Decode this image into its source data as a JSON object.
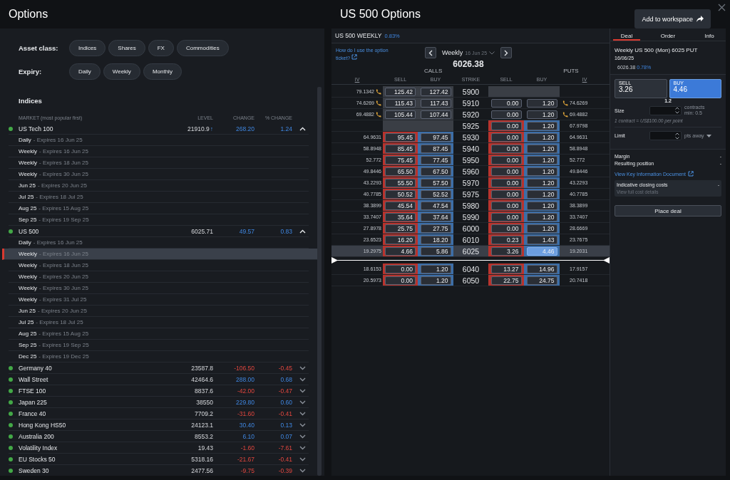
{
  "header": {
    "title": "Options",
    "chain_title": "US 500 Options",
    "add_button": "Add to workspace"
  },
  "filters": [
    {
      "label": "Asset class:",
      "chips": [
        "Indices",
        "Shares",
        "FX",
        "Commodities"
      ]
    },
    {
      "label": "Expiry:",
      "chips": [
        "Daily",
        "Weekly",
        "Monthly"
      ]
    }
  ],
  "market_list": {
    "title": "Indices",
    "columns": [
      "MARKET (most popular first)",
      "LEVEL",
      "CHANGE",
      "% CHANGE"
    ],
    "markets": [
      {
        "name": "US Tech 100",
        "open": true,
        "level": "21910.9",
        "level_arrow": "↑",
        "change": "268.20",
        "pct": "1.24",
        "rising": true,
        "expanded": true,
        "expiries": [
          {
            "label": "Daily",
            "detail": "- Expires 16 Jun 25",
            "selected": false
          },
          {
            "label": "Weekly",
            "detail": "- Expires 16 Jun 25",
            "selected": false
          },
          {
            "label": "Weekly",
            "detail": "- Expires 18 Jun 25",
            "selected": false
          },
          {
            "label": "Weekly",
            "detail": "- Expires 30 Jun 25",
            "selected": false
          },
          {
            "label": "Jun 25",
            "detail": "- Expires 20 Jun 25",
            "selected": false
          },
          {
            "label": "Jul 25",
            "detail": "- Expires 18 Jul 25",
            "selected": false
          },
          {
            "label": "Aug 25",
            "detail": "- Expires 15 Aug 25",
            "selected": false
          },
          {
            "label": "Sep 25",
            "detail": "- Expires 19 Sep 25",
            "selected": false
          }
        ]
      },
      {
        "name": "US 500",
        "open": true,
        "level": "6025.71",
        "change": "49.57",
        "pct": "0.83",
        "rising": true,
        "expanded": true,
        "expiries": [
          {
            "label": "Daily",
            "detail": "- Expires 16 Jun 25",
            "selected": false
          },
          {
            "label": "Weekly",
            "detail": "- Expires 16 Jun 25",
            "selected": true
          },
          {
            "label": "Weekly",
            "detail": "- Expires 18 Jun 25",
            "selected": false
          },
          {
            "label": "Weekly",
            "detail": "- Expires 20 Jun 25",
            "selected": false
          },
          {
            "label": "Weekly",
            "detail": "- Expires 30 Jun 25",
            "selected": false
          },
          {
            "label": "Weekly",
            "detail": "- Expires 31 Jul 25",
            "selected": false
          },
          {
            "label": "Jun 25",
            "detail": "- Expires 20 Jun 25",
            "selected": false
          },
          {
            "label": "Jul 25",
            "detail": "- Expires 18 Jul 25",
            "selected": false
          },
          {
            "label": "Aug 25",
            "detail": "- Expires 15 Aug 25",
            "selected": false
          },
          {
            "label": "Sep 25",
            "detail": "- Expires 19 Sep 25",
            "selected": false
          },
          {
            "label": "Dec 25",
            "detail": "- Expires 19 Dec 25",
            "selected": false
          }
        ]
      },
      {
        "name": "Germany 40",
        "open": true,
        "level": "23587.8",
        "change": "-106.50",
        "pct": "-0.45",
        "rising": false,
        "expanded": false
      },
      {
        "name": "Wall Street",
        "open": true,
        "level": "42464.6",
        "change": "288.00",
        "pct": "0.68",
        "rising": true,
        "expanded": false
      },
      {
        "name": "FTSE 100",
        "open": true,
        "level": "8837.6",
        "change": "-42.00",
        "pct": "-0.47",
        "rising": false,
        "expanded": false
      },
      {
        "name": "Japan 225",
        "open": true,
        "level": "38550",
        "change": "229.80",
        "pct": "0.60",
        "rising": true,
        "expanded": false
      },
      {
        "name": "France 40",
        "open": true,
        "level": "7709.2",
        "change": "-31.60",
        "pct": "-0.41",
        "rising": false,
        "expanded": false
      },
      {
        "name": "Hong Kong HS50",
        "open": true,
        "level": "24123.1",
        "change": "30.40",
        "pct": "0.13",
        "rising": true,
        "expanded": false
      },
      {
        "name": "Australia 200",
        "open": true,
        "level": "8553.2",
        "change": "6.10",
        "pct": "0.07",
        "rising": true,
        "expanded": false
      },
      {
        "name": "Volatility Index",
        "open": true,
        "level": "19.43",
        "change": "-1.60",
        "pct": "-7.61",
        "rising": false,
        "expanded": false
      },
      {
        "name": "EU Stocks 50",
        "open": true,
        "level": "5318.16",
        "change": "-21.67",
        "pct": "-0.41",
        "rising": false,
        "expanded": false
      },
      {
        "name": "Sweden 30",
        "open": true,
        "level": "2477.56",
        "change": "-9.75",
        "pct": "-0.39",
        "rising": false,
        "expanded": false
      }
    ]
  },
  "chain": {
    "title": "US 500 WEEKLY",
    "change": "0.83%",
    "help_link": "How do I use the option ticket?",
    "expiry_type": "Weekly",
    "expiry_date": "16 Jun 25",
    "underlying": "6026.38",
    "calls_label": "CALLS",
    "puts_label": "PUTS",
    "columns": [
      "IV",
      "SELL",
      "BUY",
      "STRIKE",
      "SELL",
      "BUY",
      "IV"
    ],
    "rows": [
      {
        "iv_call": "79.1342",
        "call_sell": "125.42",
        "call_buy": "127.42",
        "strike": "5900",
        "put_sell": null,
        "put_buy": null,
        "iv_put": null,
        "call_colored": false,
        "call_greyed": true,
        "put_colored": false,
        "put_greyed": true,
        "call_phone": true,
        "put_phone": false,
        "selected": false,
        "quote_selected": false,
        "price_line_below": false
      },
      {
        "iv_call": "74.6269",
        "call_sell": "115.43",
        "call_buy": "117.43",
        "strike": "5910",
        "put_sell": "0.00",
        "put_buy": "1.20",
        "iv_put": "74.6269",
        "call_colored": false,
        "call_greyed": true,
        "put_colored": false,
        "put_greyed": false,
        "call_phone": true,
        "put_phone": true,
        "selected": false,
        "quote_selected": false,
        "price_line_below": false
      },
      {
        "iv_call": "69.4882",
        "call_sell": "105.44",
        "call_buy": "107.44",
        "strike": "5920",
        "put_sell": "0.00",
        "put_buy": "1.20",
        "iv_put": "69.4882",
        "call_colored": false,
        "call_greyed": true,
        "put_colored": false,
        "put_greyed": false,
        "call_phone": true,
        "put_phone": true,
        "selected": false,
        "quote_selected": false,
        "price_line_below": false
      },
      {
        "iv_call": null,
        "call_sell": null,
        "call_buy": null,
        "strike": "5925",
        "put_sell": "0.00",
        "put_buy": "1.20",
        "iv_put": "67.9798",
        "call_colored": false,
        "call_greyed": true,
        "put_colored": true,
        "put_greyed": false,
        "call_phone": false,
        "put_phone": false,
        "selected": false,
        "quote_selected": false,
        "price_line_below": false
      },
      {
        "iv_call": "64.9631",
        "call_sell": "95.45",
        "call_buy": "97.45",
        "strike": "5930",
        "put_sell": "0.00",
        "put_buy": "1.20",
        "iv_put": "64.9631",
        "call_colored": true,
        "call_greyed": false,
        "put_colored": true,
        "put_greyed": false,
        "call_phone": false,
        "put_phone": false,
        "selected": false,
        "quote_selected": false,
        "price_line_below": false
      },
      {
        "iv_call": "58.8948",
        "call_sell": "85.45",
        "call_buy": "87.45",
        "strike": "5940",
        "put_sell": "0.00",
        "put_buy": "1.20",
        "iv_put": "58.8948",
        "call_colored": true,
        "call_greyed": false,
        "put_colored": true,
        "put_greyed": false,
        "call_phone": false,
        "put_phone": false,
        "selected": false,
        "quote_selected": false,
        "price_line_below": false
      },
      {
        "iv_call": "52.772",
        "call_sell": "75.45",
        "call_buy": "77.45",
        "strike": "5950",
        "put_sell": "0.00",
        "put_buy": "1.20",
        "iv_put": "52.772",
        "call_colored": true,
        "call_greyed": false,
        "put_colored": true,
        "put_greyed": false,
        "call_phone": false,
        "put_phone": false,
        "selected": false,
        "quote_selected": false,
        "price_line_below": false
      },
      {
        "iv_call": "49.8446",
        "call_sell": "65.50",
        "call_buy": "67.50",
        "strike": "5960",
        "put_sell": "0.00",
        "put_buy": "1.20",
        "iv_put": "49.8446",
        "call_colored": true,
        "call_greyed": false,
        "put_colored": true,
        "put_greyed": false,
        "call_phone": false,
        "put_phone": false,
        "selected": false,
        "quote_selected": false,
        "price_line_below": false
      },
      {
        "iv_call": "43.2293",
        "call_sell": "55.50",
        "call_buy": "57.50",
        "strike": "5970",
        "put_sell": "0.00",
        "put_buy": "1.20",
        "iv_put": "43.2293",
        "call_colored": true,
        "call_greyed": false,
        "put_colored": true,
        "put_greyed": false,
        "call_phone": false,
        "put_phone": false,
        "selected": false,
        "quote_selected": false,
        "price_line_below": false
      },
      {
        "iv_call": "40.7785",
        "call_sell": "50.52",
        "call_buy": "52.52",
        "strike": "5975",
        "put_sell": "0.00",
        "put_buy": "1.20",
        "iv_put": "40.7785",
        "call_colored": true,
        "call_greyed": false,
        "put_colored": true,
        "put_greyed": false,
        "call_phone": false,
        "put_phone": false,
        "selected": false,
        "quote_selected": false,
        "price_line_below": false
      },
      {
        "iv_call": "38.3899",
        "call_sell": "45.54",
        "call_buy": "47.54",
        "strike": "5980",
        "put_sell": "0.00",
        "put_buy": "1.20",
        "iv_put": "38.3899",
        "call_colored": true,
        "call_greyed": false,
        "put_colored": true,
        "put_greyed": false,
        "call_phone": false,
        "put_phone": false,
        "selected": false,
        "quote_selected": false,
        "price_line_below": false
      },
      {
        "iv_call": "33.7407",
        "call_sell": "35.64",
        "call_buy": "37.64",
        "strike": "5990",
        "put_sell": "0.00",
        "put_buy": "1.20",
        "iv_put": "33.7407",
        "call_colored": true,
        "call_greyed": false,
        "put_colored": true,
        "put_greyed": false,
        "call_phone": false,
        "put_phone": false,
        "selected": false,
        "quote_selected": false,
        "price_line_below": false
      },
      {
        "iv_call": "27.8978",
        "call_sell": "25.75",
        "call_buy": "27.75",
        "strike": "6000",
        "put_sell": "0.00",
        "put_buy": "1.20",
        "iv_put": "28.6669",
        "call_colored": true,
        "call_greyed": false,
        "put_colored": true,
        "put_greyed": false,
        "call_phone": false,
        "put_phone": false,
        "selected": false,
        "quote_selected": false,
        "price_line_below": false
      },
      {
        "iv_call": "23.6523",
        "call_sell": "16.20",
        "call_buy": "18.20",
        "strike": "6010",
        "put_sell": "0.23",
        "put_buy": "1.43",
        "iv_put": "23.7675",
        "call_colored": true,
        "call_greyed": false,
        "put_colored": true,
        "put_greyed": false,
        "call_phone": false,
        "put_phone": false,
        "selected": false,
        "quote_selected": false,
        "price_line_below": false
      },
      {
        "iv_call": "19.2975",
        "call_sell": "4.66",
        "call_buy": "5.86",
        "strike": "6025",
        "put_sell": "3.26",
        "put_buy": "4.46",
        "iv_put": "19.2031",
        "call_colored": true,
        "call_greyed": false,
        "put_colored": true,
        "put_greyed": false,
        "call_phone": false,
        "put_phone": false,
        "selected": true,
        "quote_selected": true,
        "price_line_below": true
      },
      {
        "iv_call": "18.6153",
        "call_sell": "0.00",
        "call_buy": "1.20",
        "strike": "6040",
        "put_sell": "13.27",
        "put_buy": "14.96",
        "iv_put": "17.9157",
        "call_colored": true,
        "call_greyed": false,
        "put_colored": true,
        "put_greyed": false,
        "call_phone": false,
        "put_phone": false,
        "selected": false,
        "quote_selected": false,
        "price_line_below": false
      },
      {
        "iv_call": "20.5973",
        "call_sell": "0.00",
        "call_buy": "1.20",
        "strike": "6050",
        "put_sell": "22.75",
        "put_buy": "24.75",
        "iv_put": "20.7418",
        "call_colored": true,
        "call_greyed": false,
        "put_colored": true,
        "put_greyed": false,
        "call_phone": false,
        "put_phone": false,
        "selected": false,
        "quote_selected": false,
        "price_line_below": false
      }
    ]
  },
  "ticket": {
    "tabs": [
      {
        "label": "Deal",
        "selected": true
      },
      {
        "label": "Order",
        "selected": false
      },
      {
        "label": "Info",
        "selected": false
      }
    ],
    "title": "Weekly US 500 (Mon) 6025 PUT",
    "date": "16/06/25",
    "price": "6026.38",
    "change": "0.78%",
    "sell": {
      "label": "SELL",
      "price": "3.26",
      "selected": false
    },
    "buy": {
      "label": "BUY",
      "price": "4.46",
      "selected": true
    },
    "spread": "1.2",
    "size_label": "Size",
    "size_unit": "contracts",
    "size_min": "min: 0.5",
    "contract_note": "1 contract = US$100.00 per point",
    "limit_label": "Limit",
    "limit_unit": "pts away",
    "summary": [
      {
        "label": "Margin",
        "value": "-"
      },
      {
        "label": "Resulting position",
        "value": "-"
      }
    ],
    "kid_link": "View Key Information Document",
    "costs_label": "Indicative closing costs",
    "costs_value": "-",
    "costs_link": "View full cost details",
    "place_button": "Place deal"
  }
}
